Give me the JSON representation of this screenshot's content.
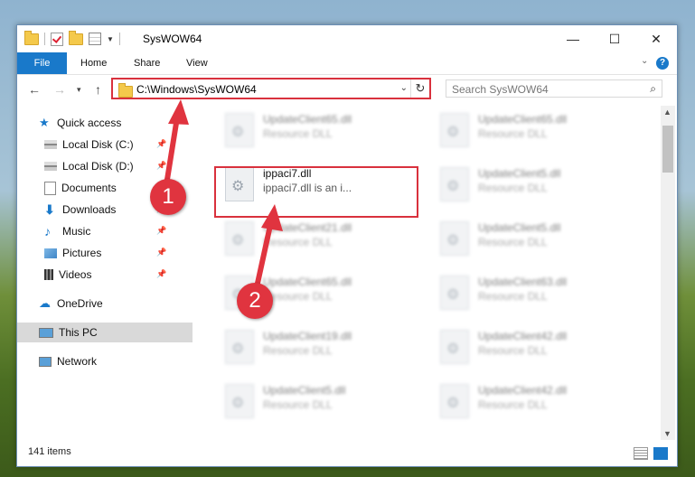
{
  "window": {
    "title": "SysWOW64",
    "controls": {
      "minimize": "—",
      "maximize": "☐",
      "close": "✕"
    }
  },
  "ribbon": {
    "tabs": [
      {
        "label": "File"
      },
      {
        "label": "Home"
      },
      {
        "label": "Share"
      },
      {
        "label": "View"
      }
    ],
    "help_label": "?"
  },
  "nav": {
    "address_path": "C:\\Windows\\SysWOW64",
    "search_placeholder": "Search SysWOW64"
  },
  "sidebar": {
    "items": [
      {
        "label": "Quick access",
        "icon": "star-icon",
        "pinned": false
      },
      {
        "label": "Local Disk (C:)",
        "icon": "drive-icon",
        "pinned": true
      },
      {
        "label": "Local Disk (D:)",
        "icon": "drive-icon",
        "pinned": true
      },
      {
        "label": "Documents",
        "icon": "documents-icon",
        "pinned": true
      },
      {
        "label": "Downloads",
        "icon": "download-icon",
        "pinned": true
      },
      {
        "label": "Music",
        "icon": "music-icon",
        "pinned": true
      },
      {
        "label": "Pictures",
        "icon": "pictures-icon",
        "pinned": true
      },
      {
        "label": "Videos",
        "icon": "videos-icon",
        "pinned": true
      },
      {
        "label": "OneDrive",
        "icon": "cloud-icon",
        "pinned": false
      },
      {
        "label": "This PC",
        "icon": "computer-icon",
        "pinned": false,
        "selected": true
      },
      {
        "label": "Network",
        "icon": "network-icon",
        "pinned": false
      }
    ]
  },
  "files": [
    {
      "name": "UpdateClient65.dll",
      "desc": "Resource DLL"
    },
    {
      "name": "UpdateClient65.dll",
      "desc": "Resource DLL"
    },
    {
      "name": "ippaci7.dll",
      "desc": "ippaci7.dll is an i..."
    },
    {
      "name": "UpdateClient5.dll",
      "desc": "Resource DLL"
    },
    {
      "name": "UpdateClient21.dll",
      "desc": "Resource DLL"
    },
    {
      "name": "UpdateClient5.dll",
      "desc": "Resource DLL"
    },
    {
      "name": "UpdateClient65.dll",
      "desc": "Resource DLL"
    },
    {
      "name": "UpdateClient63.dll",
      "desc": "Resource DLL"
    },
    {
      "name": "UpdateClient19.dll",
      "desc": "Resource DLL"
    },
    {
      "name": "UpdateClient42.dll",
      "desc": "Resource DLL"
    },
    {
      "name": "UpdateClient5.dll",
      "desc": "Resource DLL"
    },
    {
      "name": "UpdateClient42.dll",
      "desc": "Resource DLL"
    }
  ],
  "status": {
    "item_count": "141 items"
  },
  "annotations": {
    "badge1": "1",
    "badge2": "2"
  },
  "colors": {
    "accent": "#1979ca",
    "highlight": "#d9313d"
  }
}
